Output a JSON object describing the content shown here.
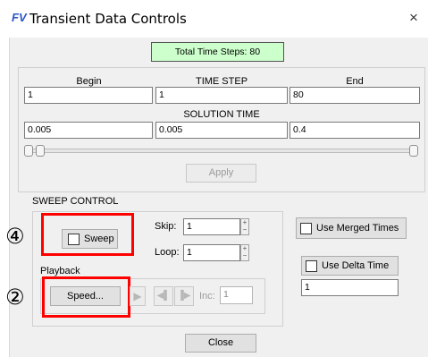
{
  "window": {
    "logo": "FV",
    "title": "Transient Data Controls",
    "close_glyph": "×"
  },
  "total_steps": "Total Time Steps: 80",
  "time_step": {
    "begin_label": "Begin",
    "mid_label": "TIME STEP",
    "end_label": "End",
    "begin_value": "1",
    "mid_value": "1",
    "end_value": "80"
  },
  "solution_time": {
    "label": "SOLUTION TIME",
    "begin_value": "0.005",
    "mid_value": "0.005",
    "end_value": "0.4"
  },
  "apply_label": "Apply",
  "sweep_control": {
    "label": "SWEEP CONTROL",
    "sweep_label": "Sweep",
    "skip_label": "Skip:",
    "skip_value": "1",
    "loop_label": "Loop:",
    "loop_value": "1",
    "playback_label": "Playback",
    "speed_label": "Speed...",
    "inc_label": "Inc:",
    "inc_value": "1"
  },
  "merged_times_label": "Use Merged Times",
  "delta_time_label": "Use Delta Time",
  "delta_time_value": "1",
  "close_label": "Close",
  "annotations": {
    "num4": "④",
    "num2": "②"
  },
  "colors": {
    "total_steps_bg": "#ccffcc",
    "highlight": "#ff0000",
    "logo": "#2a56c6"
  }
}
